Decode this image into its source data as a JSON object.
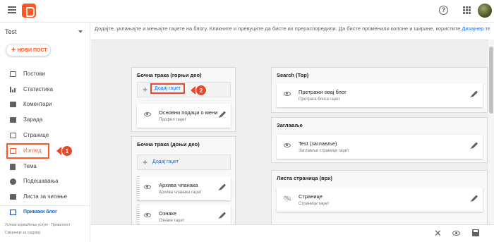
{
  "header": {
    "menu_icon": "hamburger-menu-icon",
    "logo_icon": "blogger-logo-icon",
    "help_icon": "help-circle-icon",
    "help_glyph": "?",
    "apps_icon": "apps-grid-icon",
    "avatar_icon": "account-avatar"
  },
  "sidebar": {
    "blog_name": "Test",
    "new_post_label": "НОВИ ПОСТ",
    "new_post_glyph": "+",
    "items": [
      {
        "label": "Постови",
        "icon": "posts-icon"
      },
      {
        "label": "Статистика",
        "icon": "stats-icon"
      },
      {
        "label": "Коментари",
        "icon": "comments-icon"
      },
      {
        "label": "Зарада",
        "icon": "earnings-icon"
      },
      {
        "label": "Странице",
        "icon": "pages-icon"
      },
      {
        "label": "Изглед",
        "icon": "layout-icon",
        "active": true
      },
      {
        "label": "Тема",
        "icon": "theme-icon"
      },
      {
        "label": "Подешавања",
        "icon": "settings-icon"
      },
      {
        "label": "Листа за читање",
        "icon": "reading-list-icon"
      }
    ],
    "view_blog_label": "Прикажи блог",
    "footer_links": [
      "Услови коришћења услуге",
      "Приватност",
      "Смернице за садржај"
    ],
    "footer_separator": "·"
  },
  "callouts": {
    "layout_step": "1",
    "add_gadget_step": "2",
    "color": "#e8492c"
  },
  "main": {
    "instructions": "Додајте, уклањајте и мењајте гаџете на блогу. Кликните и превуците да бисте их прераспоредили. Да бисте променили колоне и ширине, користите",
    "instructions_link": "Дизајнер тема",
    "sections": [
      {
        "title": "Бочна трака (горњи део)",
        "add_label": "Додај гаџет",
        "add_glyph": "+",
        "gadgets": [
          {
            "name": "Основни подаци о мени",
            "desc": "Профил гаџет",
            "visible": true
          }
        ]
      },
      {
        "title": "Бочна трака (доњи део)",
        "add_label": "Додај гаџет",
        "add_glyph": "+",
        "gadgets": [
          {
            "name": "Архива чланака",
            "desc": "Архива чланака гаџет",
            "visible": true
          },
          {
            "name": "Ознаке",
            "desc": "Ознаке гаџет",
            "visible": true
          }
        ]
      },
      {
        "title": "Search (Top)",
        "gadgets": [
          {
            "name": "Претражи овај блог",
            "desc": "Претрага блога гаџет",
            "visible": true
          }
        ]
      },
      {
        "title": "Заглавље",
        "gadgets": [
          {
            "name": "Test (заглавље)",
            "desc": "Заглавље странице гаџет",
            "visible": true
          }
        ]
      },
      {
        "title": "Листа страница (врх)",
        "gadgets": [
          {
            "name": "Странице",
            "desc": "Странице гаџет",
            "visible": false
          }
        ]
      }
    ]
  },
  "bottombar": {
    "close_icon": "close-icon",
    "close_glyph": "✕",
    "preview_icon": "preview-eye-icon",
    "save_icon": "save-icon"
  }
}
